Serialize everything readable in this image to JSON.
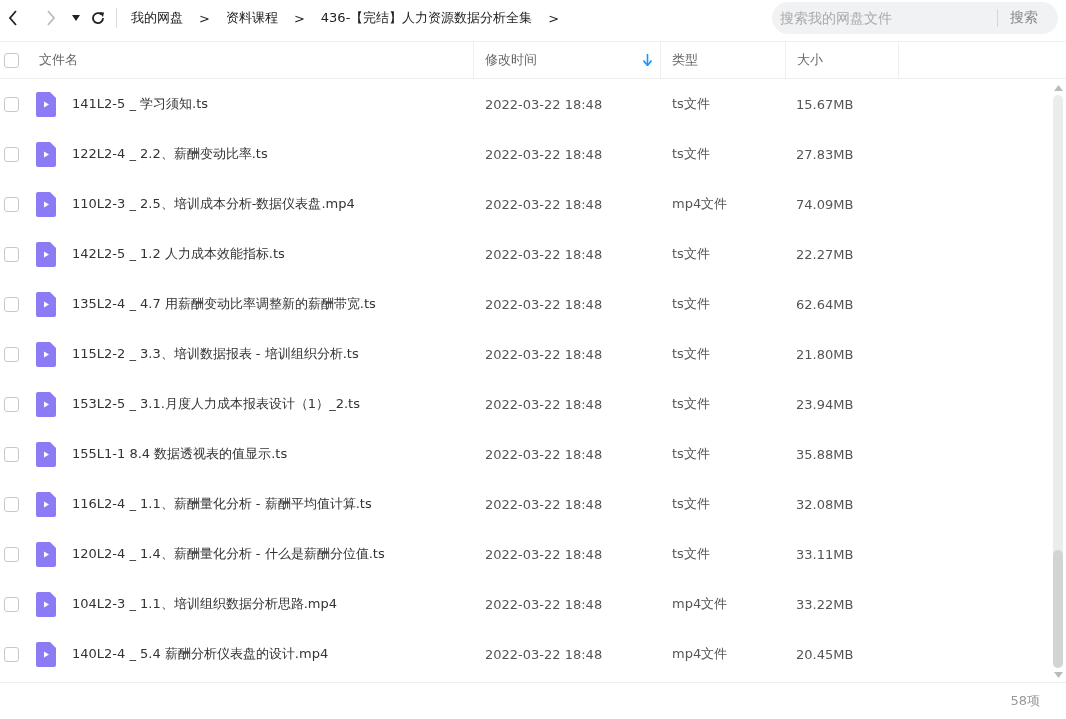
{
  "nav": {
    "back_disabled": false,
    "forward_disabled": true
  },
  "breadcrumbs": [
    "我的网盘",
    "资料课程",
    "436-【完结】人力资源数据分析全集"
  ],
  "breadcrumb_separator": ">",
  "search": {
    "placeholder": "搜索我的网盘文件",
    "button": "搜索"
  },
  "table": {
    "select_all_checked": false,
    "columns": [
      {
        "label": "文件名",
        "sorted": false
      },
      {
        "label": "修改时间",
        "sorted": true
      },
      {
        "label": "类型",
        "sorted": false
      },
      {
        "label": "大小",
        "sorted": false
      }
    ],
    "rows": [
      {
        "name": "141L2-5 _ 学习须知.ts",
        "modified": "2022-03-22 18:48",
        "type": "ts文件",
        "size": "15.67MB",
        "checked": false
      },
      {
        "name": "122L2-4 _ 2.2、薪酬变动比率.ts",
        "modified": "2022-03-22 18:48",
        "type": "ts文件",
        "size": "27.83MB",
        "checked": false
      },
      {
        "name": "110L2-3 _ 2.5、培训成本分析-数据仪表盘.mp4",
        "modified": "2022-03-22 18:48",
        "type": "mp4文件",
        "size": "74.09MB",
        "checked": false
      },
      {
        "name": "142L2-5 _ 1.2 人力成本效能指标.ts",
        "modified": "2022-03-22 18:48",
        "type": "ts文件",
        "size": "22.27MB",
        "checked": false
      },
      {
        "name": "135L2-4 _ 4.7 用薪酬变动比率调整新的薪酬带宽.ts",
        "modified": "2022-03-22 18:48",
        "type": "ts文件",
        "size": "62.64MB",
        "checked": false
      },
      {
        "name": "115L2-2 _ 3.3、培训数据报表 - 培训组织分析.ts",
        "modified": "2022-03-22 18:48",
        "type": "ts文件",
        "size": "21.80MB",
        "checked": false
      },
      {
        "name": "153L2-5 _ 3.1.月度人力成本报表设计（1）_2.ts",
        "modified": "2022-03-22 18:48",
        "type": "ts文件",
        "size": "23.94MB",
        "checked": false
      },
      {
        "name": "155L1-1 8.4 数据透视表的值显示.ts",
        "modified": "2022-03-22 18:48",
        "type": "ts文件",
        "size": "35.88MB",
        "checked": false
      },
      {
        "name": "116L2-4 _ 1.1、薪酬量化分析 - 薪酬平均值计算.ts",
        "modified": "2022-03-22 18:48",
        "type": "ts文件",
        "size": "32.08MB",
        "checked": false
      },
      {
        "name": "120L2-4 _ 1.4、薪酬量化分析 - 什么是薪酬分位值.ts",
        "modified": "2022-03-22 18:48",
        "type": "ts文件",
        "size": "33.11MB",
        "checked": false
      },
      {
        "name": "104L2-3 _ 1.1、培训组织数据分析思路.mp4",
        "modified": "2022-03-22 18:48",
        "type": "mp4文件",
        "size": "33.22MB",
        "checked": false
      },
      {
        "name": "140L2-4 _ 5.4 薪酬分析仪表盘的设计.mp4",
        "modified": "2022-03-22 18:48",
        "type": "mp4文件",
        "size": "20.45MB",
        "checked": false
      }
    ]
  },
  "footer": {
    "count": "58项"
  }
}
